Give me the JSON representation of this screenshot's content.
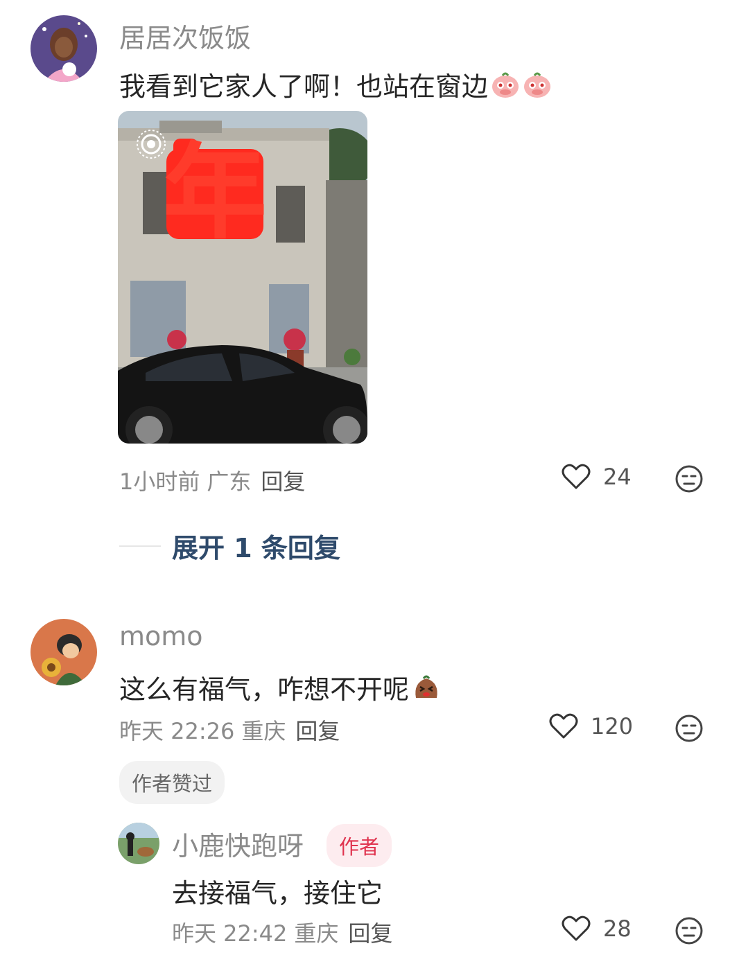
{
  "comments": [
    {
      "username": "居居次饭饭",
      "text": "我看到它家人了啊！也站在窗边",
      "emojis": [
        "blush-face-emoji",
        "blush-face-emoji"
      ],
      "time": "1小时前",
      "location": "广东",
      "reply_label": "回复",
      "likes": "24",
      "expand_label": "展开 1 条回复",
      "image": {
        "description_icon": "live-photo-icon",
        "sign_char": "年"
      }
    },
    {
      "username": "momo",
      "text": "这么有福气，咋想不开呢",
      "emojis": [
        "laughing-potato-emoji"
      ],
      "time": "昨天 22:26",
      "location": "重庆",
      "reply_label": "回复",
      "likes": "120",
      "badge": "作者赞过"
    },
    {
      "username": "小鹿快跑呀",
      "author_tag": "作者",
      "text": "去接福气，接住它",
      "time": "昨天 22:42",
      "location": "重庆",
      "reply_label": "回复",
      "likes": "28"
    }
  ],
  "colors": {
    "accent_link": "#2e4a6b",
    "author_tag": "#e0344f",
    "muted_text": "#8a8a8a"
  }
}
